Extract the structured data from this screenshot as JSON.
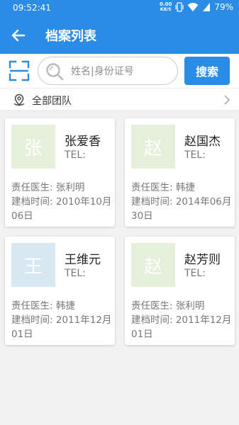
{
  "status_bar": {
    "time": "09:52:41",
    "net_speed_value": "0.00",
    "net_speed_unit": "KB/S",
    "battery": "79%"
  },
  "app_bar": {
    "title": "档案列表"
  },
  "search": {
    "placeholder": "姓名|身份证号",
    "button_label": "搜索"
  },
  "team_filter": {
    "label": "全部团队"
  },
  "records": [
    {
      "avatar_char": "张",
      "avatar_color": "#e6efd9",
      "name": "张爱香",
      "tel": "TEL:",
      "doctor": "责任医生:  张利明",
      "created": "建档时间:  2010年10月06日"
    },
    {
      "avatar_char": "赵",
      "avatar_color": "#e6efd9",
      "name": "赵国杰",
      "tel": "TEL:",
      "doctor": "责任医生:  韩捷",
      "created": "建档时间:  2014年06月30日"
    },
    {
      "avatar_char": "王",
      "avatar_color": "#d7e8f3",
      "name": "王维元",
      "tel": "TEL:",
      "doctor": "责任医生:  韩捷",
      "created": "建档时间:  2011年12月01日"
    },
    {
      "avatar_char": "赵",
      "avatar_color": "#e6efd9",
      "name": "赵芳则",
      "tel": "TEL:",
      "doctor": "责任医生:  张利明",
      "created": "建档时间:  2011年12月01日"
    }
  ],
  "colors": {
    "primary": "#2b8ce6",
    "background": "#f2f2f2"
  }
}
